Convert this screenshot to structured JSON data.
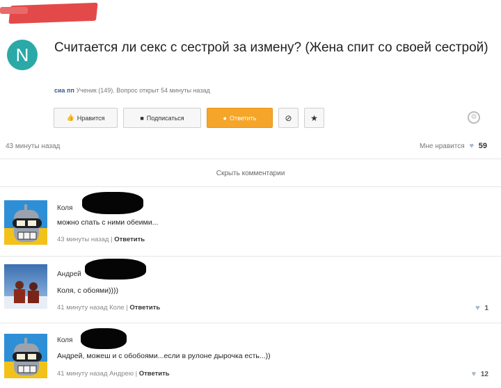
{
  "question": {
    "avatar_letter": "N",
    "title": "Считается ли секс с сестрой за измену? (Жена спит со своей сестрой)",
    "author": "сиа пп",
    "meta": "Ученик (149). Вопрос открыт 54 минуты назад"
  },
  "actions": {
    "like": "Нравится",
    "subscribe": "Подписаться",
    "answer": "Ответить",
    "icon_block": "⊘",
    "icon_star": "★"
  },
  "stats": {
    "time": "43 минуты назад",
    "likes_label": "Мне нравится",
    "likes_count": "59"
  },
  "hide_comments": "Скрыть комментарии",
  "comments": [
    {
      "name": "Коля",
      "text": "можно спать с ними обеими...",
      "time": "43 минуты назад",
      "reply": "Ответить",
      "likes": ""
    },
    {
      "name": "Андрей",
      "text": "Коля, с обоями))))",
      "time": "41 минуту назад Коле",
      "reply": "Ответить",
      "likes": "1"
    },
    {
      "name": "Коля",
      "text": "Андрей, можеш и с обобоями...если в рулоне дырочка есть...))",
      "time": "41 минуту назад Андрею",
      "reply": "Ответить",
      "likes": "12"
    }
  ],
  "colors": {
    "avatar_teal": "#2aa9a8",
    "answer_orange": "#f4a52a",
    "link_blue": "#3b5a88"
  }
}
